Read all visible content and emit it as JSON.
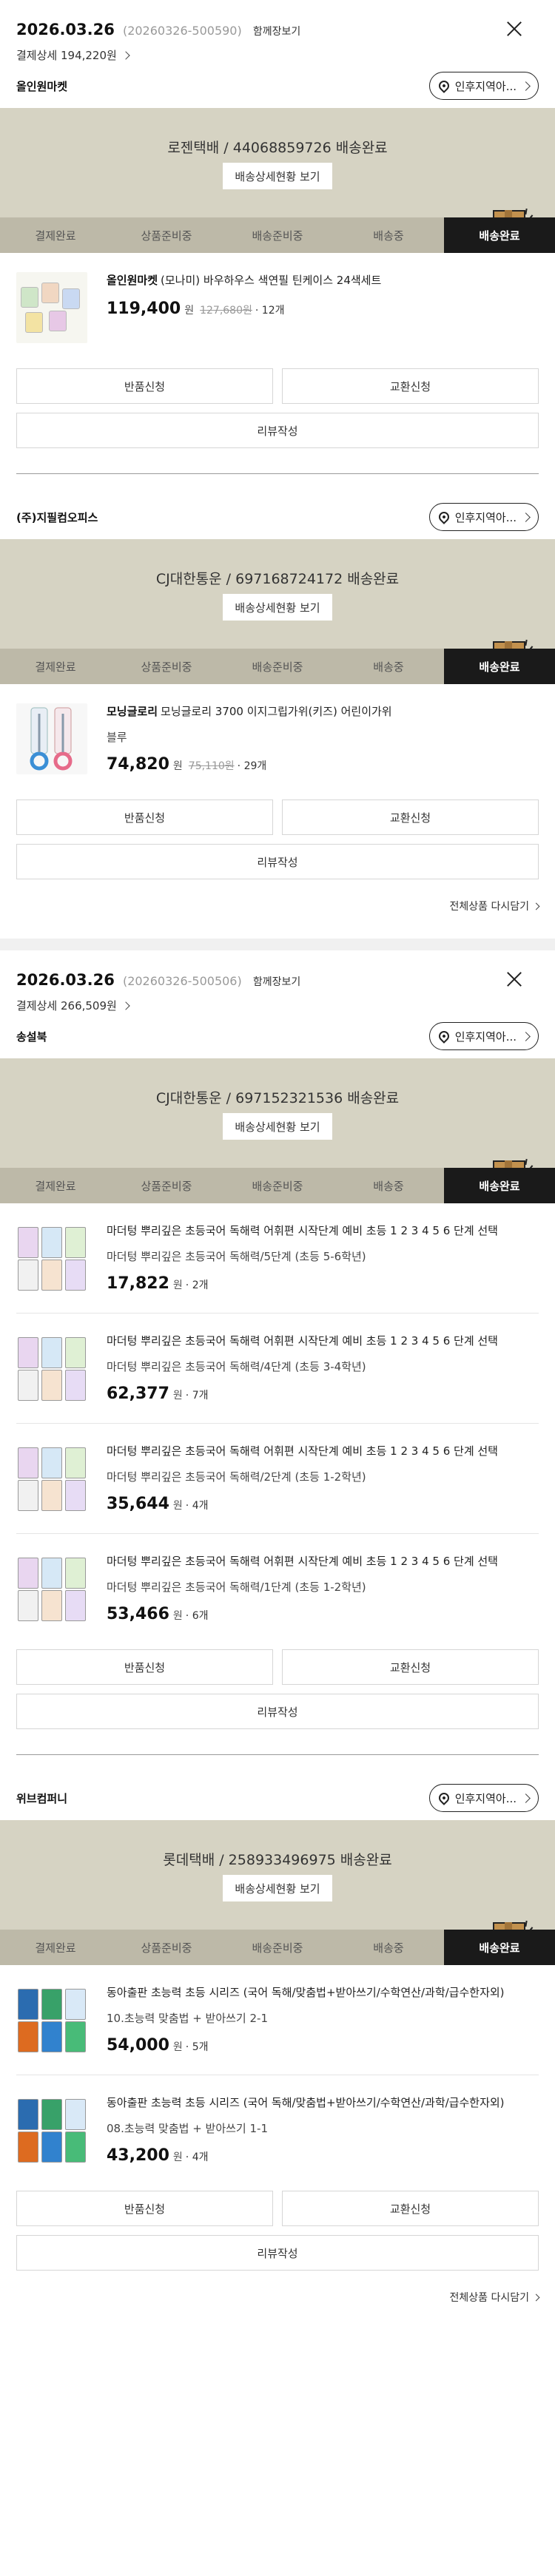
{
  "common": {
    "ship_to": "함께장보기",
    "pay_detail_prefix": "결제상세",
    "location_button": "인후지역아...",
    "detail_button": "배송상세현황 보기",
    "steps": [
      "결제완료",
      "상품준비중",
      "배송준비중",
      "배송중",
      "배송완료"
    ],
    "won": "원",
    "return_button": "반품신청",
    "exchange_button": "교환신청",
    "review_button": "리뷰작성",
    "more_link": "전체상품 다시담기"
  },
  "orders": [
    {
      "date": "2026.03.26",
      "order_no": "(20260326-500590)",
      "pay_amount": "194,220원",
      "sellers": [
        {
          "name": "올인원마켓",
          "tracking": "로젠택배 / 44068859726 배송완료",
          "items": [
            {
              "brand": "올인원마켓",
              "name": "(모나미) 바우하우스 색연필 틴케이스 24색세트",
              "option": "",
              "price": "119,400",
              "original_price": "127,680원",
              "qty": "12개"
            }
          ]
        },
        {
          "name": "(주)지필컴오피스",
          "tracking": "CJ대한통운 / 697168724172 배송완료",
          "items": [
            {
              "brand": "모닝글로리",
              "name": "모닝글로리 3700 이지그립가위(키즈) 어린이가위",
              "option": "블루",
              "price": "74,820",
              "original_price": "75,110원",
              "qty": "29개"
            }
          ]
        }
      ]
    },
    {
      "date": "2026.03.26",
      "order_no": "(20260326-500506)",
      "pay_amount": "266,509원",
      "sellers": [
        {
          "name": "송설북",
          "tracking": "CJ대한통운 / 697152321536 배송완료",
          "items": [
            {
              "brand": "",
              "name": "마더텅 뿌리깊은 초등국어 독해력 어휘편 시작단계 예비 초등 1 2 3 4 5 6 단계 선택",
              "option": "마더텅 뿌리깊은 초등국어 독해력/5단계 (초등 5-6학년)",
              "price": "17,822",
              "original_price": "",
              "qty": "2개"
            },
            {
              "brand": "",
              "name": "마더텅 뿌리깊은 초등국어 독해력 어휘편 시작단계 예비 초등 1 2 3 4 5 6 단계 선택",
              "option": "마더텅 뿌리깊은 초등국어 독해력/4단계 (초등 3-4학년)",
              "price": "62,377",
              "original_price": "",
              "qty": "7개"
            },
            {
              "brand": "",
              "name": "마더텅 뿌리깊은 초등국어 독해력 어휘편 시작단계 예비 초등 1 2 3 4 5 6 단계 선택",
              "option": "마더텅 뿌리깊은 초등국어 독해력/2단계 (초등 1-2학년)",
              "price": "35,644",
              "original_price": "",
              "qty": "4개"
            },
            {
              "brand": "",
              "name": "마더텅 뿌리깊은 초등국어 독해력 어휘편 시작단계 예비 초등 1 2 3 4 5 6 단계 선택",
              "option": "마더텅 뿌리깊은 초등국어 독해력/1단계 (초등 1-2학년)",
              "price": "53,466",
              "original_price": "",
              "qty": "6개"
            }
          ]
        },
        {
          "name": "위브컴퍼니",
          "tracking": "롯데택배 / 258933496975 배송완료",
          "items": [
            {
              "brand": "",
              "name": "동아출판 초능력 초등 시리즈 (국어 독해/맞춤법+받아쓰기/수학연산/과학/급수한자외)",
              "option": "10.초능력 맞춤법 + 받아쓰기 2-1",
              "price": "54,000",
              "original_price": "",
              "qty": "5개"
            },
            {
              "brand": "",
              "name": "동아출판 초능력 초등 시리즈 (국어 독해/맞춤법+받아쓰기/수학연산/과학/급수한자외)",
              "option": "08.초능력 맞춤법 + 받아쓰기 1-1",
              "price": "43,200",
              "original_price": "",
              "qty": "4개"
            }
          ]
        }
      ]
    }
  ]
}
